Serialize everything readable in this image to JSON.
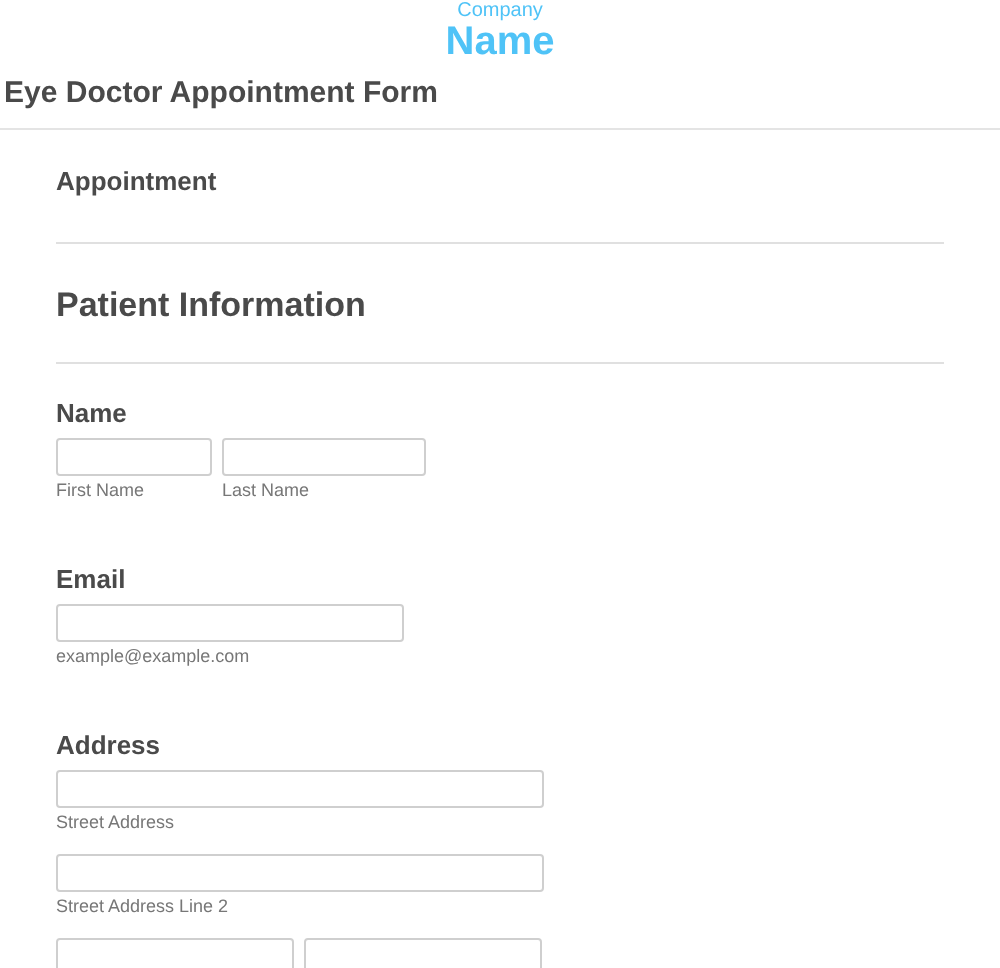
{
  "logo": {
    "line_1": "Company",
    "line_2": "Name"
  },
  "form": {
    "title": "Eye Doctor Appointment Form"
  },
  "sections": [
    {
      "kind": "subheading",
      "text": "Appointment"
    },
    {
      "kind": "heading",
      "text": "Patient Information"
    }
  ],
  "fields": [
    {
      "kind": "name",
      "label": "Name",
      "inputs": [
        {
          "sublabel": "First Name"
        },
        {
          "sublabel": "Last Name"
        }
      ]
    },
    {
      "kind": "email",
      "label": "Email",
      "inputs": [
        {
          "sublabel": "example@example.com"
        }
      ]
    },
    {
      "kind": "address",
      "label": "Address",
      "inputs": [
        {
          "sublabel": "Street Address"
        }
      ]
    },
    {
      "kind": "address",
      "inputs": [
        {
          "sublabel": "Street Address Line 2"
        }
      ]
    },
    {
      "kind": "pair"
    }
  ]
}
